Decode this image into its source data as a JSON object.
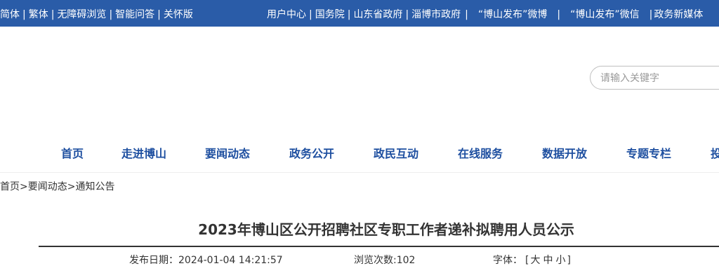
{
  "topbar": {
    "left_links": [
      "简体",
      "繁体",
      "无障碍浏览",
      "智能问答",
      "关怀版"
    ],
    "right_links": [
      "用户中心",
      "国务院",
      "山东省政府",
      "淄博市政府",
      "“博山发布”微博",
      "“博山发布”微信",
      "政务新媒体"
    ]
  },
  "search": {
    "placeholder": "请输入关键字"
  },
  "nav": {
    "items": [
      "首页",
      "走进博山",
      "要闻动态",
      "政务公开",
      "政民互动",
      "在线服务",
      "数据开放",
      "专题专栏",
      "投"
    ]
  },
  "breadcrumb": {
    "items": [
      "首页",
      "要闻动态",
      "通知公告"
    ],
    "separator": ">"
  },
  "article": {
    "title": "2023年博山区公开招聘社区专职工作者递补拟聘用人员公示",
    "publish_label": "发布日期：",
    "publish_date": "2024-01-04 14:21:57",
    "views_label": "浏览次数:",
    "views_count": "102",
    "font_label": "字体：",
    "font_open": "[",
    "font_sizes": [
      "大",
      "中",
      "小"
    ],
    "font_close": "]"
  },
  "colors": {
    "topbar_bg": "#2a5ca8",
    "nav_text": "#1e4fa0"
  }
}
